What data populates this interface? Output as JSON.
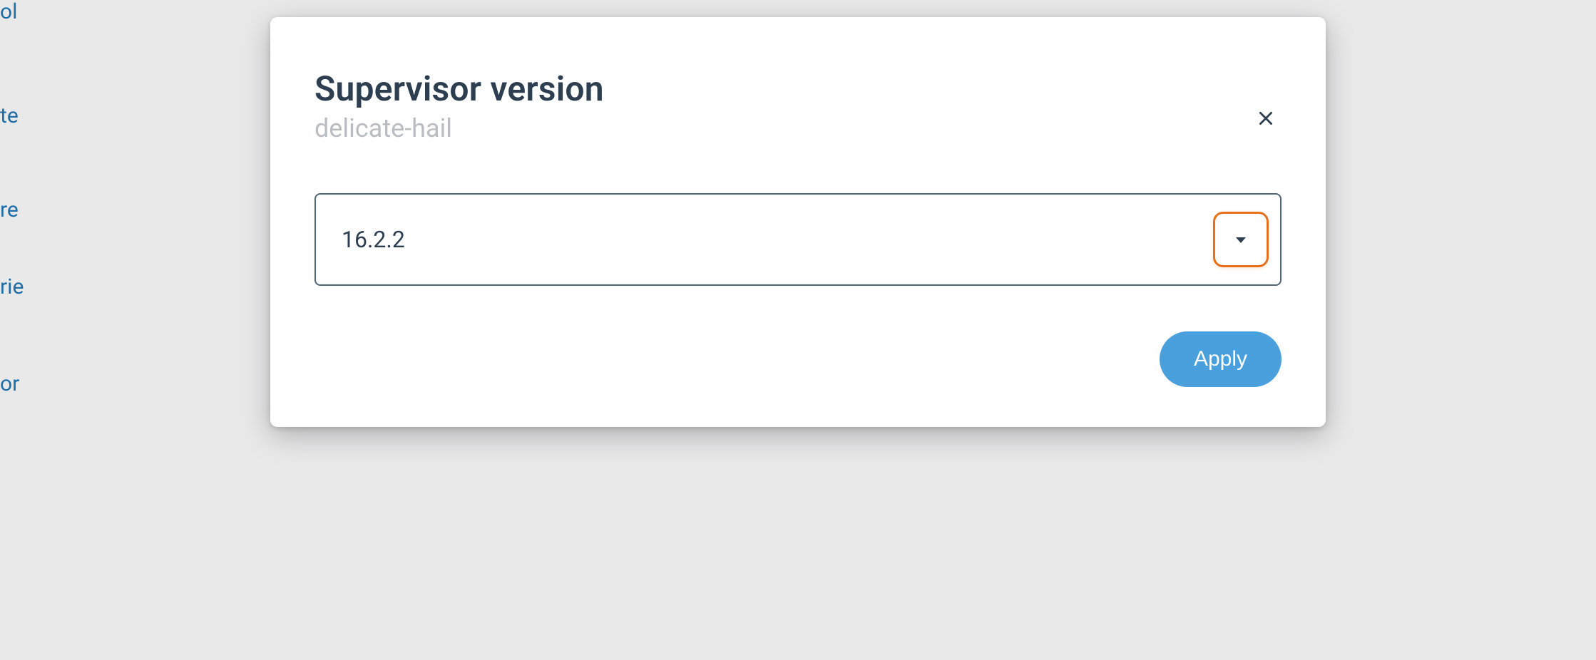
{
  "modal": {
    "title": "Supervisor version",
    "subtitle": "delicate-hail",
    "select": {
      "value": "16.2.2"
    },
    "apply_label": "Apply"
  },
  "background_partial_words": [
    "ol",
    "te",
    "re",
    "rie",
    "or"
  ]
}
